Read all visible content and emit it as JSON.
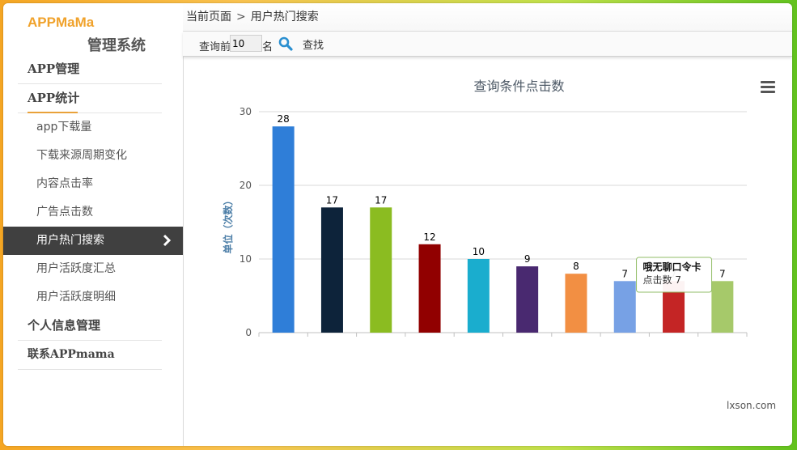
{
  "sidebar": {
    "brand_top": "APPMaMa",
    "brand_sub": "管理系统",
    "groups": [
      {
        "label": "APP管理"
      },
      {
        "label": "APP统计"
      },
      {
        "label": "个人信息管理"
      },
      {
        "label": "联系APPmama"
      }
    ],
    "items": [
      {
        "label": "app下载量"
      },
      {
        "label": "下载来源周期变化"
      },
      {
        "label": "内容点击率"
      },
      {
        "label": "广告点击数"
      },
      {
        "label": "用户热门搜索"
      },
      {
        "label": "用户活跃度汇总"
      },
      {
        "label": "用户活跃度明细"
      }
    ]
  },
  "breadcrumb": {
    "root": "当前页面",
    "separator": ">",
    "current": "用户热门搜索"
  },
  "toolbar": {
    "query_prefix": "查询前",
    "count_value": "10",
    "count_suffix": "名",
    "find_label": "查找"
  },
  "watermark": "lxson.com",
  "tooltip": {
    "title": "哦无聊口令卡",
    "label": "点击数",
    "value": "7"
  },
  "colors": {
    "bars": [
      "#2f7ed8",
      "#0d233a",
      "#8bbc21",
      "#910000",
      "#1aadce",
      "#492970",
      "#f28f43",
      "#77a1e5",
      "#c42525",
      "#a6c96a"
    ],
    "accent": "#f0a22b",
    "active_menu_bg": "#404040"
  },
  "chart_data": {
    "type": "bar",
    "title": "查询条件点击数",
    "ylabel": "单位（次数）",
    "xlabel": "",
    "ylim": [
      0,
      30
    ],
    "yticks": [
      0,
      10,
      20,
      30
    ],
    "values": [
      28,
      17,
      17,
      12,
      10,
      9,
      8,
      7,
      7,
      7
    ],
    "grid": true,
    "legend": "none"
  }
}
